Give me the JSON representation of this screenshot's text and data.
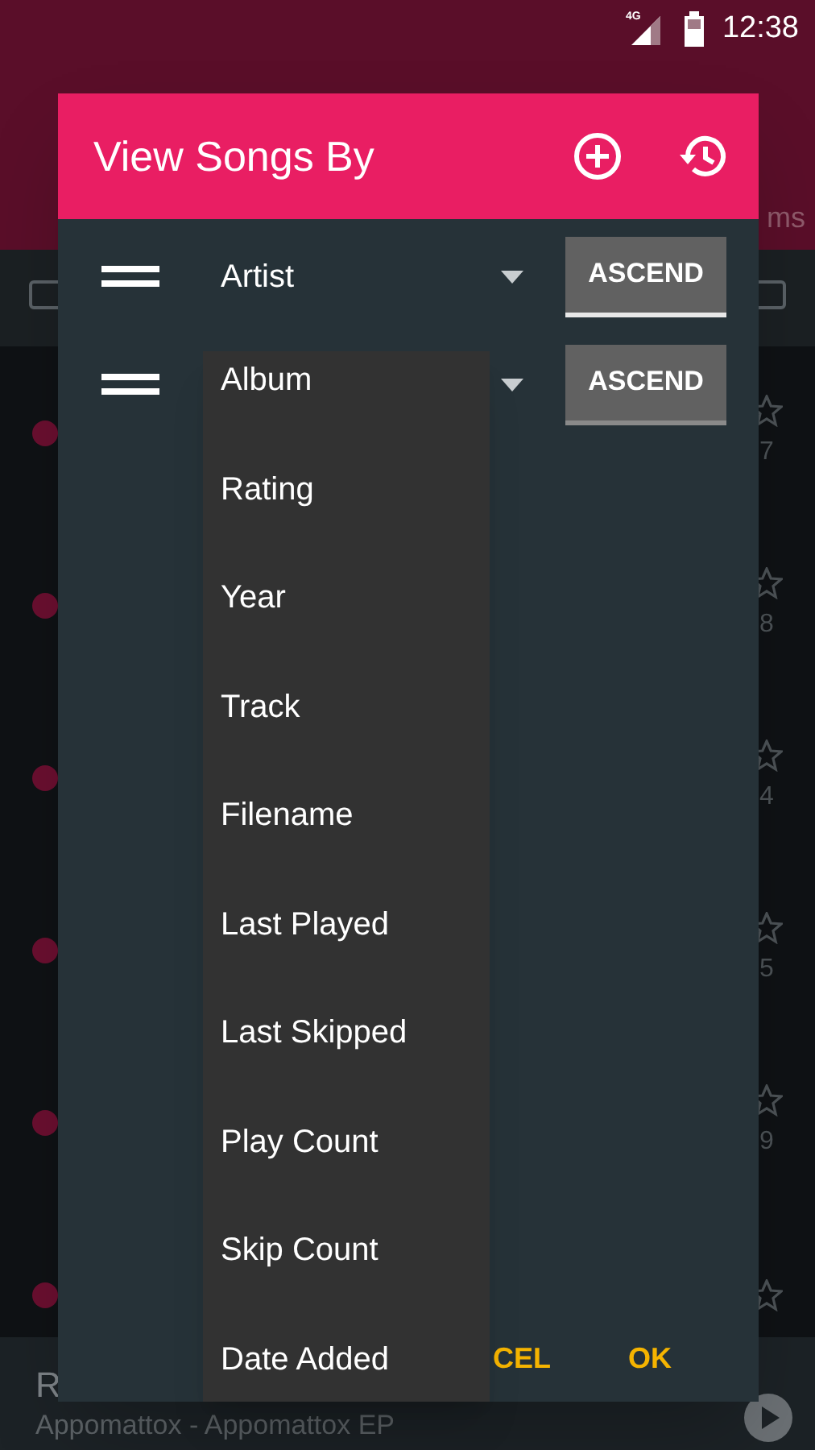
{
  "status_bar": {
    "network": "4G",
    "time": "12:38"
  },
  "background": {
    "header_fragment": "ms",
    "rows": [
      {
        "count": "7"
      },
      {
        "count": "8"
      },
      {
        "count": "4"
      },
      {
        "count": "5"
      },
      {
        "count": "9"
      },
      {}
    ],
    "now_playing": {
      "title": "R",
      "subtitle": "Appomattox - Appomattox EP"
    }
  },
  "dialog": {
    "title": "View Songs By",
    "sort_rows": [
      {
        "field": "Artist",
        "order": "ASCEND",
        "focused": true
      },
      {
        "order": "ASCEND",
        "focused": false
      }
    ],
    "buttons": [
      "CEL",
      "OK"
    ]
  },
  "dropdown": {
    "items": [
      "Album",
      "Rating",
      "Year",
      "Track",
      "Filename",
      "Last Played",
      "Last Skipped",
      "Play Count",
      "Skip Count",
      "Date Added"
    ]
  }
}
